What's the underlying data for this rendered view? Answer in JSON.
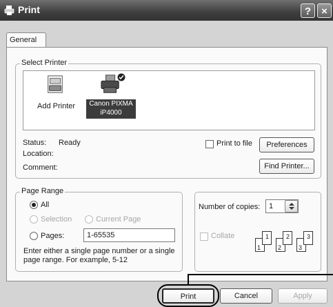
{
  "window": {
    "title": "Print",
    "help_label": "?",
    "close_label": "×"
  },
  "tabs": [
    {
      "label": "General"
    }
  ],
  "select_printer": {
    "legend": "Select Printer",
    "printers": [
      {
        "label": "Add Printer",
        "selected": false
      },
      {
        "label_line1": "Canon PIXMA",
        "label_line2": "iP4000",
        "selected": true
      }
    ],
    "status_label": "Status:",
    "status_value": "Ready",
    "location_label": "Location:",
    "comment_label": "Comment:",
    "print_to_file_label": "Print to file",
    "preferences_label": "Preferences",
    "find_printer_label": "Find Printer..."
  },
  "page_range": {
    "legend": "Page Range",
    "all_label": "All",
    "selection_label": "Selection",
    "current_page_label": "Current Page",
    "pages_label": "Pages:",
    "pages_value": "1-65535",
    "hint": "Enter either a single page number or a single page range.  For example, 5-12",
    "selected": "All"
  },
  "copies": {
    "number_label": "Number of copies:",
    "number_value": "1",
    "collate_label": "Collate",
    "collate_pages": [
      "1",
      "1",
      "2",
      "2",
      "3",
      "3"
    ]
  },
  "footer": {
    "print_label": "Print",
    "cancel_label": "Cancel",
    "apply_label": "Apply"
  },
  "colors": {
    "title_bar": "#4a4a4a",
    "dialog_bg": "#d4d4d4",
    "panel_bg": "#fafafa",
    "selected_item": "#3c3c3c",
    "callout": "#000000"
  }
}
